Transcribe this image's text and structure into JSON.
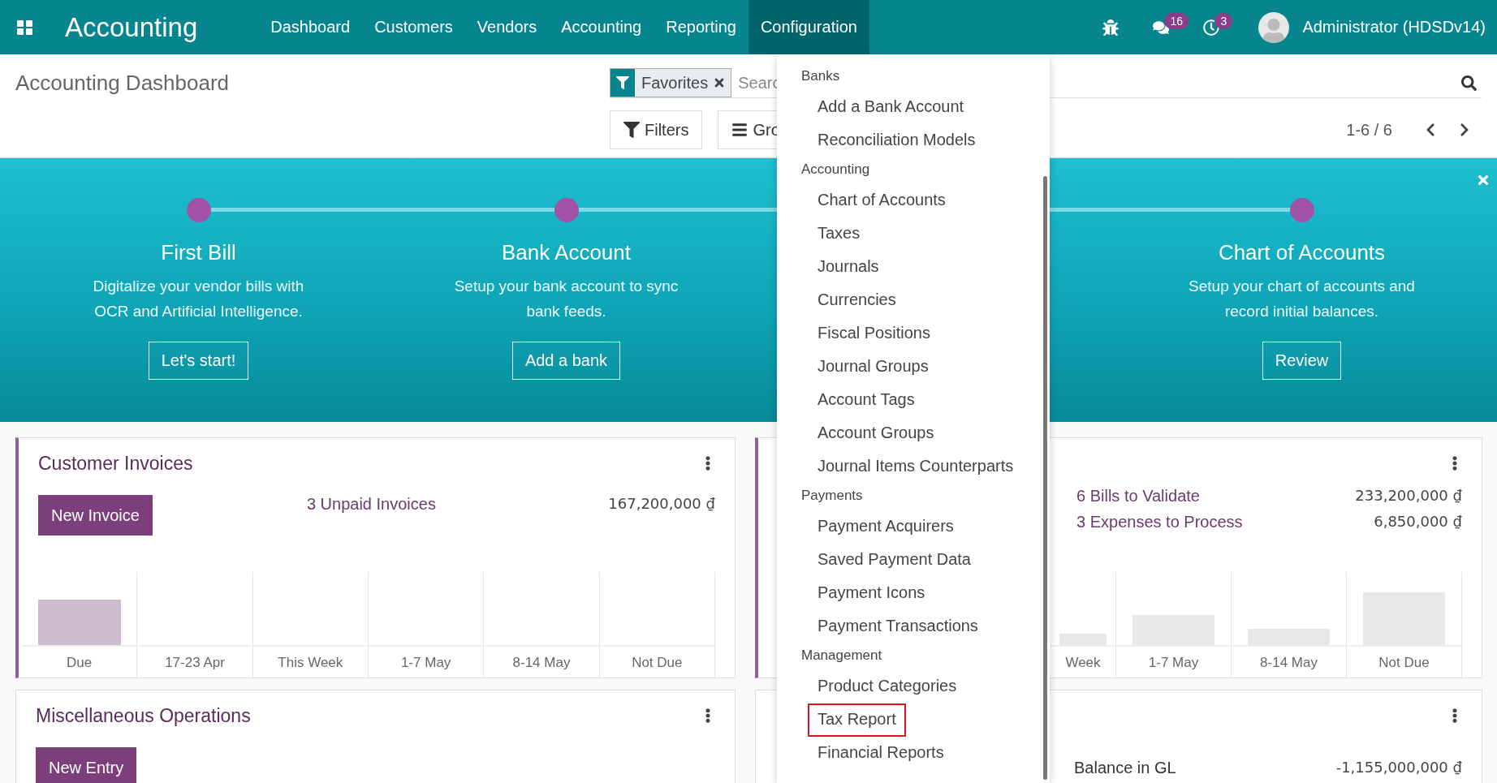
{
  "navbar": {
    "app_name": "Accounting",
    "menu": [
      {
        "label": "Dashboard",
        "selected": false
      },
      {
        "label": "Customers",
        "selected": false
      },
      {
        "label": "Vendors",
        "selected": false
      },
      {
        "label": "Accounting",
        "selected": false
      },
      {
        "label": "Reporting",
        "selected": false
      },
      {
        "label": "Configuration",
        "selected": true
      }
    ],
    "messages_badge": "16",
    "activities_badge": "3",
    "user": "Administrator (HDSDv14)"
  },
  "control_panel": {
    "title": "Accounting Dashboard",
    "facet": "Favorites",
    "search_placeholder": "Searc",
    "buttons": [
      {
        "kind": "filter",
        "label": "Filters"
      },
      {
        "kind": "group",
        "label": "Gro"
      }
    ],
    "pager": "1-6 / 6"
  },
  "banner": {
    "steps": [
      {
        "title": "First Bill",
        "text": "Digitalize your vendor bills with OCR and Artificial Intelligence.",
        "button": "Let's start!"
      },
      {
        "title": "Bank Account",
        "text": "Setup your bank account to sync bank feeds.",
        "button": "Add a bank"
      },
      {
        "title": "Chart of Accounts",
        "text": "Setup your chart of accounts and record initial balances.",
        "button": "Review"
      }
    ]
  },
  "dropdown": {
    "sections": [
      {
        "header": "Banks",
        "items": [
          {
            "label": "Add a Bank Account",
            "highlighted": false
          },
          {
            "label": "Reconciliation Models",
            "highlighted": false
          }
        ]
      },
      {
        "header": "Accounting",
        "items": [
          {
            "label": "Chart of Accounts",
            "highlighted": false
          },
          {
            "label": "Taxes",
            "highlighted": false
          },
          {
            "label": "Journals",
            "highlighted": false
          },
          {
            "label": "Currencies",
            "highlighted": false
          },
          {
            "label": "Fiscal Positions",
            "highlighted": false
          },
          {
            "label": "Journal Groups",
            "highlighted": false
          },
          {
            "label": "Account Tags",
            "highlighted": false
          },
          {
            "label": "Account Groups",
            "highlighted": false
          },
          {
            "label": "Journal Items Counterparts",
            "highlighted": false
          }
        ]
      },
      {
        "header": "Payments",
        "items": [
          {
            "label": "Payment Acquirers",
            "highlighted": false
          },
          {
            "label": "Saved Payment Data",
            "highlighted": false
          },
          {
            "label": "Payment Icons",
            "highlighted": false
          },
          {
            "label": "Payment Transactions",
            "highlighted": false
          }
        ]
      },
      {
        "header": "Management",
        "items": [
          {
            "label": "Product Categories",
            "highlighted": false
          },
          {
            "label": "Tax Report",
            "highlighted": true
          },
          {
            "label": "Financial Reports",
            "highlighted": false
          }
        ]
      }
    ]
  },
  "cards_left": [
    {
      "title": "Customer Invoices",
      "button": "New Invoice",
      "rows": [
        {
          "kind": "link",
          "label": "3 Unpaid Invoices",
          "amount": "167,200,000 ₫"
        }
      ],
      "chart_labels": [
        "Due",
        "17-23 Apr",
        "This Week",
        "1-7 May",
        "8-14 May",
        "Not Due"
      ]
    },
    {
      "title": "Miscellaneous Operations",
      "button": "New Entry"
    }
  ],
  "cards_right": [
    {
      "rows": [
        {
          "kind": "link",
          "label": "6 Bills to Validate",
          "amount": "233,200,000 ₫"
        },
        {
          "kind": "link",
          "label": "3 Expenses to Process",
          "amount": "6,850,000 ₫"
        }
      ],
      "chart_labels": [
        "Week",
        "1-7 May",
        "8-14 May",
        "Not Due"
      ]
    },
    {
      "rows": [
        {
          "kind": "plain",
          "label": "Balance in GL",
          "amount": "-1,155,000,000 ₫"
        }
      ]
    }
  ]
}
